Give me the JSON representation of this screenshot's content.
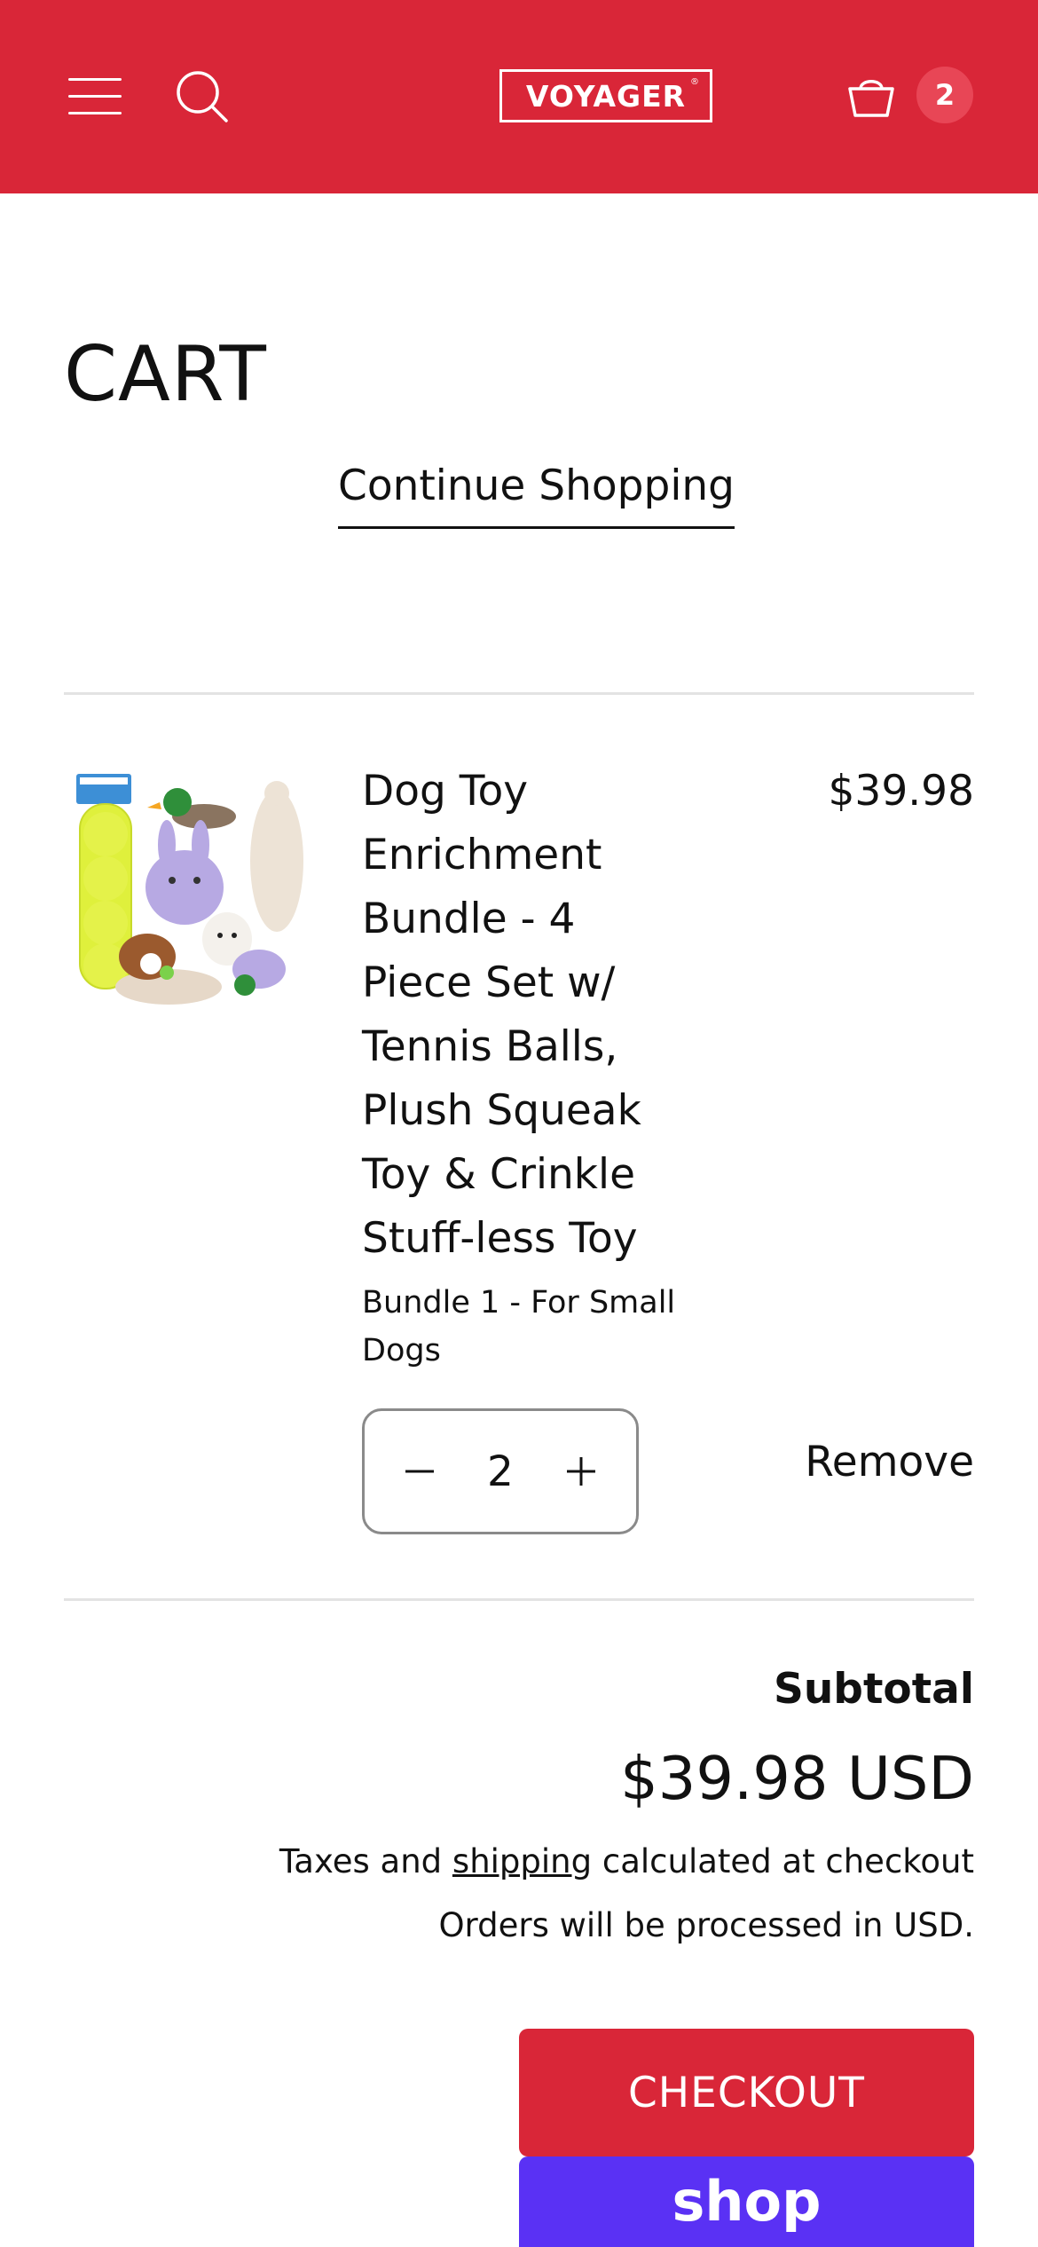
{
  "header": {
    "menu_icon": "hamburger-menu-icon",
    "search_icon": "search-icon",
    "logo_text": "VOYAGER",
    "logo_mark": "®",
    "cart_icon": "basket-icon",
    "cart_count": "2",
    "background_color": "#d92638"
  },
  "page": {
    "title": "CART",
    "continue_label": "Continue Shopping"
  },
  "cart": {
    "items": [
      {
        "title": "Dog Toy Enrichment Bundle - 4 Piece Set w/ Tennis Balls, Plush Squeak Toy & Crinkle Stuff-less Toy",
        "variant": "Bundle 1 - For Small Dogs",
        "price": "$39.98",
        "quantity": "2",
        "remove_label": "Remove",
        "image_icon": "product-image"
      }
    ]
  },
  "summary": {
    "subtotal_label": "Subtotal",
    "subtotal_value": "$39.98 USD",
    "taxes_prefix": "Taxes and ",
    "taxes_link": "shipping",
    "taxes_suffix": " calculated at checkout",
    "currency_note": "Orders will be processed in USD.",
    "checkout_label": "CHECKOUT",
    "shop_pay_label": "shop"
  },
  "colors": {
    "brand_red": "#d92638",
    "shop_pay_purple": "#5a31f4"
  }
}
